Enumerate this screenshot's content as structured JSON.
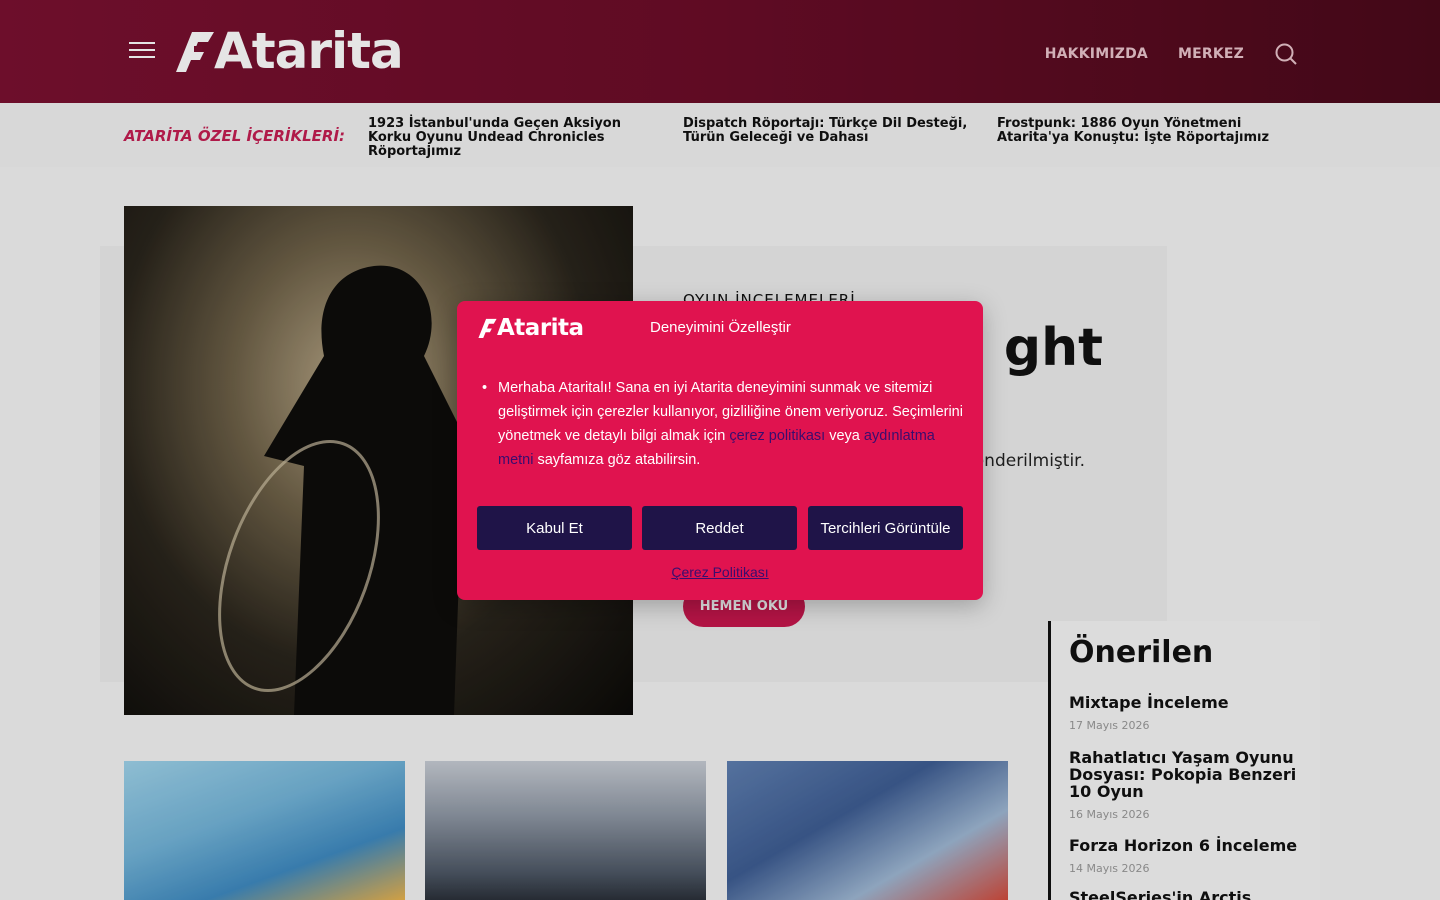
{
  "header": {
    "logo_text": "Atarita",
    "nav": [
      "HAKKIMIZDA",
      "MERKEZ"
    ]
  },
  "special": {
    "label": "ATARİTA ÖZEL İÇERİKLERİ:",
    "items": [
      "1923 İstanbul'unda Geçen Aksiyon Korku Oyunu Undead Chronicles Röportajımız",
      "Dispatch Röportajı: Türkçe Dil Desteği, Türün Geleceği ve Dahası",
      "Frostpunk: 1886 Oyun Yönetmeni Atarita'ya Konuştu: İşte Röportajımız"
    ]
  },
  "hero": {
    "category": "OYUN İNCELEMELERİ",
    "title": "ght",
    "description": "eme kopyası, önderilmiştir.",
    "cta": "HEMEN OKU"
  },
  "sidebar": {
    "title": "Önerilen",
    "items": [
      {
        "title": "Mixtape İnceleme",
        "date": "17 Mayıs 2026"
      },
      {
        "title": "Rahatlatıcı Yaşam Oyunu Dosyası: Pokopia Benzeri 10 Oyun",
        "date": "16 Mayıs 2026"
      },
      {
        "title": "Forza Horizon 6 İnceleme",
        "date": "14 Mayıs 2026"
      },
      {
        "title": "SteelSeries'in Arctis Nova",
        "date": ""
      }
    ]
  },
  "modal": {
    "logo_text": "Atarita",
    "title": "Deneyimini Özelleştir",
    "body_before": "Merhaba Ataritalı! Sana en iyi Atarita deneyimini sunmak ve sitemizi geliştirmek için çerezler kullanıyor, gizliliğine önem veriyoruz. Seçimlerini yönetmek ve detaylı bilgi almak için ",
    "link1": "çerez politikası",
    "body_mid": " veya ",
    "link2": "aydınlatma metni",
    "body_after": " sayfamıza göz atabilirsin.",
    "buttons": {
      "accept": "Kabul Et",
      "reject": "Reddet",
      "prefs": "Tercihleri Görüntüle"
    },
    "policy_link": "Çerez Politikası"
  },
  "colors": {
    "brand": "#e0134f",
    "header": "#6a0d28",
    "button": "#1f1448"
  }
}
